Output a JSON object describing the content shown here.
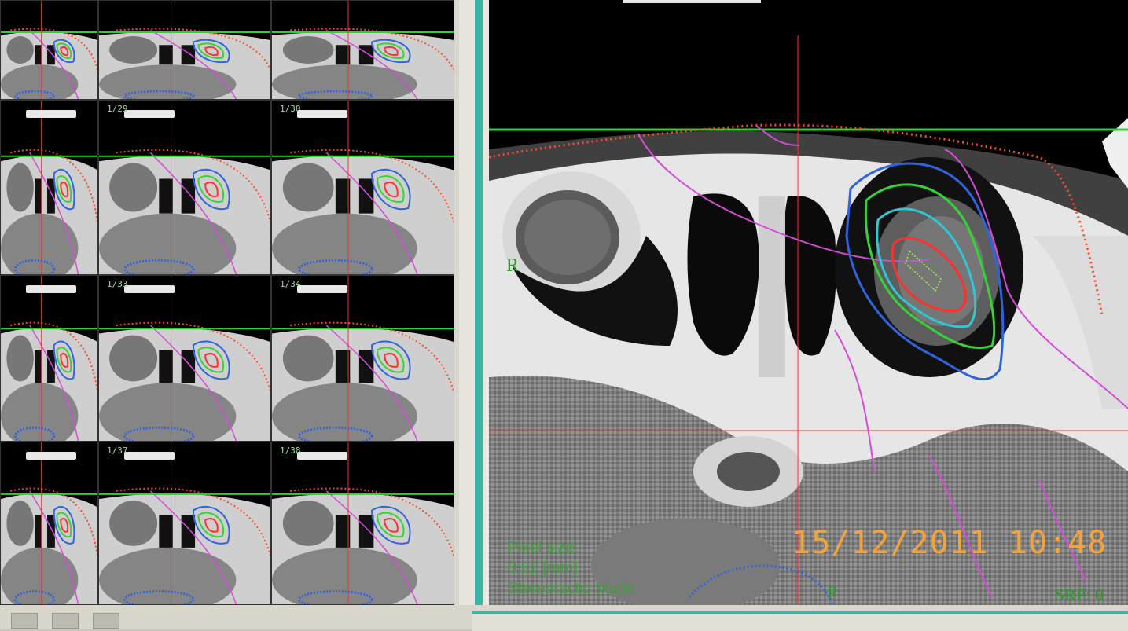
{
  "thumbnails": [
    {
      "label": ""
    },
    {
      "label": ""
    },
    {
      "label": ""
    },
    {
      "label": ""
    },
    {
      "label": "1/29"
    },
    {
      "label": "1/30"
    },
    {
      "label": ""
    },
    {
      "label": "1/33"
    },
    {
      "label": "1/34"
    },
    {
      "label": ""
    },
    {
      "label": "1/37"
    },
    {
      "label": "1/38"
    }
  ],
  "main_view": {
    "orientation_left": "R",
    "orientation_bottom": "P",
    "corner_label": "SRP: 0",
    "info_lines": [
      "Pixel size:",
      "0.52 [mm]",
      "Stereotactic Mode"
    ],
    "timestamp": "15/12/2011  10:48"
  },
  "colors": {
    "contour_red": "#ff3030",
    "contour_green": "#35d335",
    "contour_cyan": "#2fc6d6",
    "contour_blue": "#2f63e0",
    "contour_magenta": "#d54bd8",
    "dotted_red": "#ff4a2a",
    "grid_green": "#2bd42b",
    "timestamp_orange": "#f3a33a"
  }
}
